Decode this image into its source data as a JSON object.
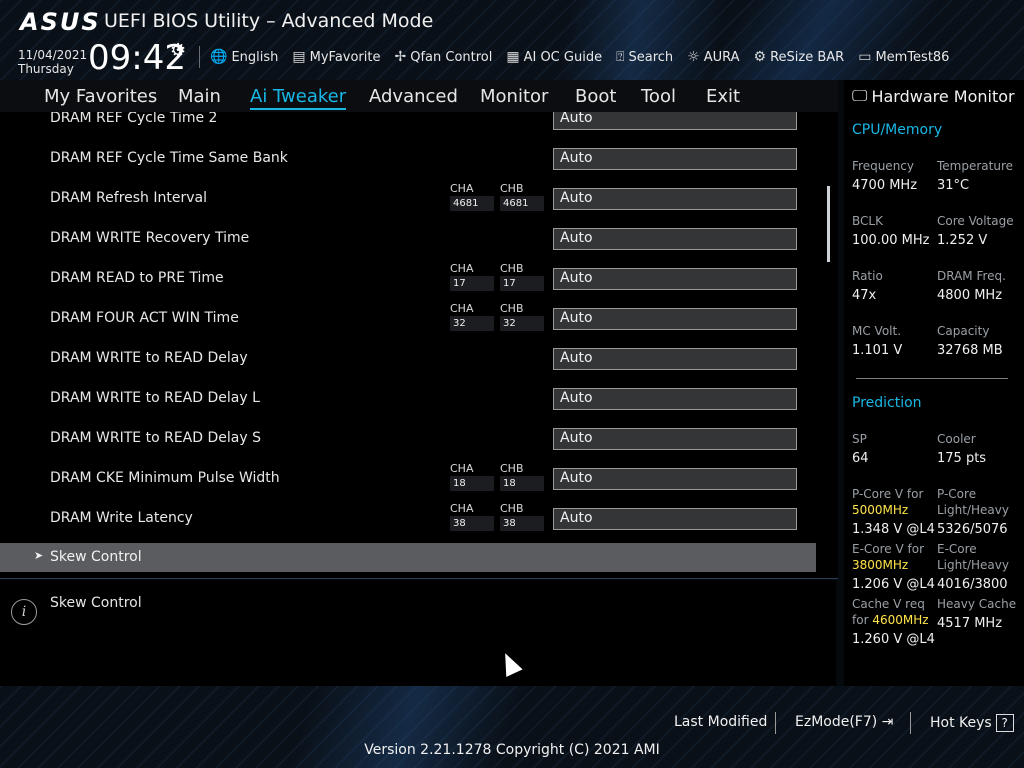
{
  "header": {
    "brand": "ASUS",
    "title": "UEFI BIOS Utility – Advanced Mode",
    "date": "11/04/2021",
    "day": "Thursday",
    "time": "09:42",
    "toolbar": [
      {
        "label": "English",
        "icon": "globe-icon"
      },
      {
        "label": "MyFavorite",
        "icon": "favorite-icon"
      },
      {
        "label": "Qfan Control",
        "icon": "fan-icon"
      },
      {
        "label": "AI OC Guide",
        "icon": "oc-guide-icon"
      },
      {
        "label": "Search",
        "icon": "search-icon"
      },
      {
        "label": "AURA",
        "icon": "aura-icon"
      },
      {
        "label": "ReSize BAR",
        "icon": "resize-bar-icon"
      },
      {
        "label": "MemTest86",
        "icon": "memtest-icon"
      }
    ]
  },
  "nav": {
    "tabs": [
      "My Favorites",
      "Main",
      "Ai Tweaker",
      "Advanced",
      "Monitor",
      "Boot",
      "Tool",
      "Exit"
    ],
    "active": "Ai Tweaker"
  },
  "settings": {
    "rows": [
      {
        "label": "DRAM REF Cycle Time 2",
        "value": "Auto",
        "cha": "",
        "chb": ""
      },
      {
        "label": "DRAM REF Cycle Time Same Bank",
        "value": "Auto",
        "cha": "",
        "chb": ""
      },
      {
        "label": "DRAM Refresh Interval",
        "value": "Auto",
        "cha": "4681",
        "chb": "4681"
      },
      {
        "label": "DRAM WRITE Recovery Time",
        "value": "Auto",
        "cha": "",
        "chb": ""
      },
      {
        "label": "DRAM READ to PRE Time",
        "value": "Auto",
        "cha": "17",
        "chb": "17"
      },
      {
        "label": "DRAM FOUR ACT WIN Time",
        "value": "Auto",
        "cha": "32",
        "chb": "32"
      },
      {
        "label": "DRAM WRITE to READ Delay",
        "value": "Auto",
        "cha": "",
        "chb": ""
      },
      {
        "label": "DRAM WRITE to READ Delay L",
        "value": "Auto",
        "cha": "",
        "chb": ""
      },
      {
        "label": "DRAM WRITE to READ Delay S",
        "value": "Auto",
        "cha": "",
        "chb": ""
      },
      {
        "label": "DRAM CKE Minimum Pulse Width",
        "value": "Auto",
        "cha": "18",
        "chb": "18"
      },
      {
        "label": "DRAM Write Latency",
        "value": "Auto",
        "cha": "38",
        "chb": "38"
      }
    ],
    "channel_a": "CHA",
    "channel_b": "CHB",
    "submenu": "Skew Control"
  },
  "help": {
    "text": "Skew Control"
  },
  "hardware_monitor": {
    "title": "Hardware Monitor",
    "cpu_memory": {
      "heading": "CPU/Memory",
      "frequency_label": "Frequency",
      "frequency": "4700 MHz",
      "temperature_label": "Temperature",
      "temperature": "31°C",
      "bclk_label": "BCLK",
      "bclk": "100.00 MHz",
      "core_voltage_label": "Core Voltage",
      "core_voltage": "1.252 V",
      "ratio_label": "Ratio",
      "ratio": "47x",
      "dram_freq_label": "DRAM Freq.",
      "dram_freq": "4800 MHz",
      "mc_volt_label": "MC Volt.",
      "mc_volt": "1.101 V",
      "capacity_label": "Capacity",
      "capacity": "32768 MB"
    },
    "prediction": {
      "heading": "Prediction",
      "sp_label": "SP",
      "sp": "64",
      "cooler_label": "Cooler",
      "cooler": "175 pts",
      "pcore_v_label": "P-Core V for",
      "pcore_v_freq": "5000MHz",
      "pcore_v": "1.348 V @L4",
      "pcore_lh_label_1": "P-Core",
      "pcore_lh_label_2": "Light/Heavy",
      "pcore_lh": "5326/5076",
      "ecore_v_label": "E-Core V for",
      "ecore_v_freq": "3800MHz",
      "ecore_v": "1.206 V @L4",
      "ecore_lh_label_1": "E-Core",
      "ecore_lh_label_2": "Light/Heavy",
      "ecore_lh": "4016/3800",
      "cache_v_label_1": "Cache V req",
      "cache_v_label_2": "for",
      "cache_v_freq": "4600MHz",
      "cache_v": "1.260 V @L4",
      "heavy_cache_label": "Heavy Cache",
      "heavy_cache": "4517 MHz"
    }
  },
  "footer": {
    "last_modified": "Last Modified",
    "ezmode": "EzMode(F7)",
    "hot_keys": "Hot Keys",
    "hot_keys_key": "?",
    "version": "Version 2.21.1278 Copyright (C) 2021 AMI"
  },
  "colors": {
    "accent": "#19b7e6",
    "highlight_freq": "#ffe44a",
    "selected_row": "#5a5c5f"
  }
}
